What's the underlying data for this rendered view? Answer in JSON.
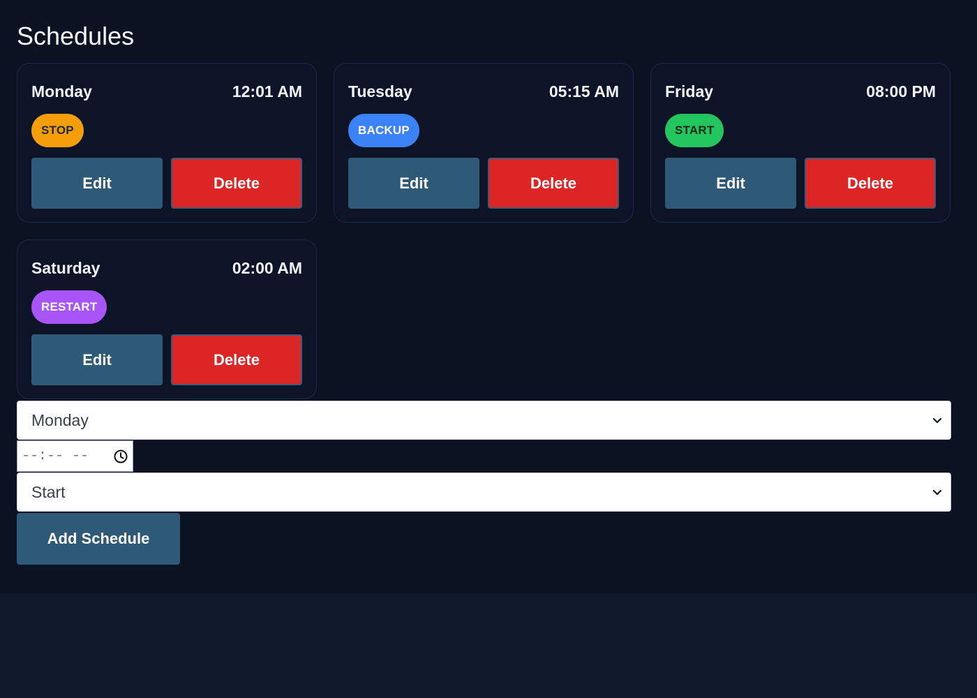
{
  "page": {
    "title": "Schedules"
  },
  "schedules": [
    {
      "day": "Monday",
      "time": "12:01 AM",
      "action": "STOP",
      "action_color": "#f59e0b",
      "edit_label": "Edit",
      "delete_label": "Delete"
    },
    {
      "day": "Tuesday",
      "time": "05:15 AM",
      "action": "BACKUP",
      "action_color": "#3b82f6",
      "edit_label": "Edit",
      "delete_label": "Delete"
    },
    {
      "day": "Friday",
      "time": "08:00 PM",
      "action": "START",
      "action_color": "#22c55e",
      "edit_label": "Edit",
      "delete_label": "Delete"
    },
    {
      "day": "Saturday",
      "time": "02:00 AM",
      "action": "RESTART",
      "action_color": "#a855f7",
      "edit_label": "Edit",
      "delete_label": "Delete"
    }
  ],
  "form": {
    "day_select": {
      "value": "Monday"
    },
    "time_input": {
      "placeholder": "--:-- --",
      "icon": "clock-icon"
    },
    "action_select": {
      "value": "Start"
    },
    "submit_label": "Add Schedule"
  },
  "colors": {
    "background": "#0b1222",
    "card_background": "#0d1428",
    "edit_button": "#2e5a78",
    "delete_button": "#dc2626"
  }
}
